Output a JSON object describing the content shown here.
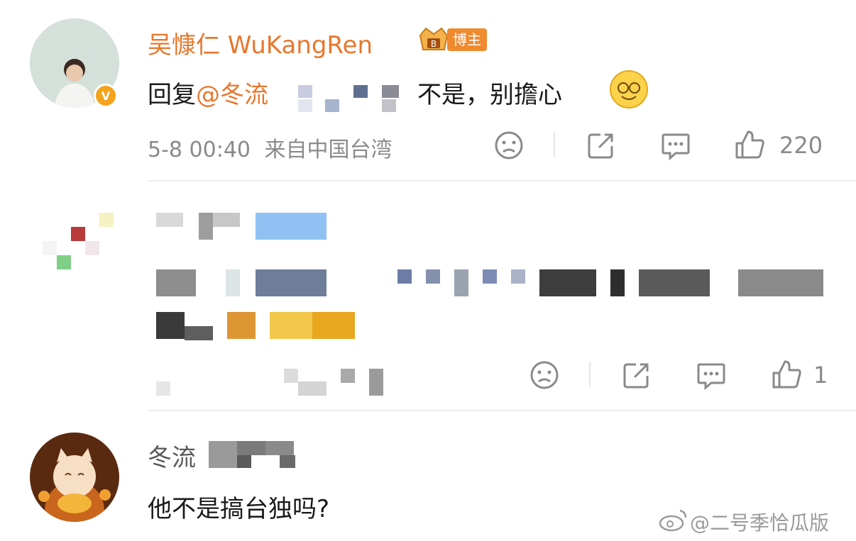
{
  "comment_1": {
    "username": "吴慷仁 WuKangRen",
    "badge_label": "博主",
    "reply_prefix": "回复",
    "mention": "@冬流",
    "text": "不是，别擔心",
    "timestamp": "5-8 00:40",
    "location": "来自中国台湾",
    "like_count": "220"
  },
  "comment_2": {
    "like_count": "1"
  },
  "comment_3": {
    "username": "冬流",
    "text": "他不是搞台独吗?"
  },
  "watermark": {
    "text": "@二号季恰瓜版"
  },
  "colors": {
    "username_accent": "#e8772e",
    "badge_bg": "#f08a2f",
    "meta_gray": "#8a8a8a",
    "divider": "#ececec"
  }
}
